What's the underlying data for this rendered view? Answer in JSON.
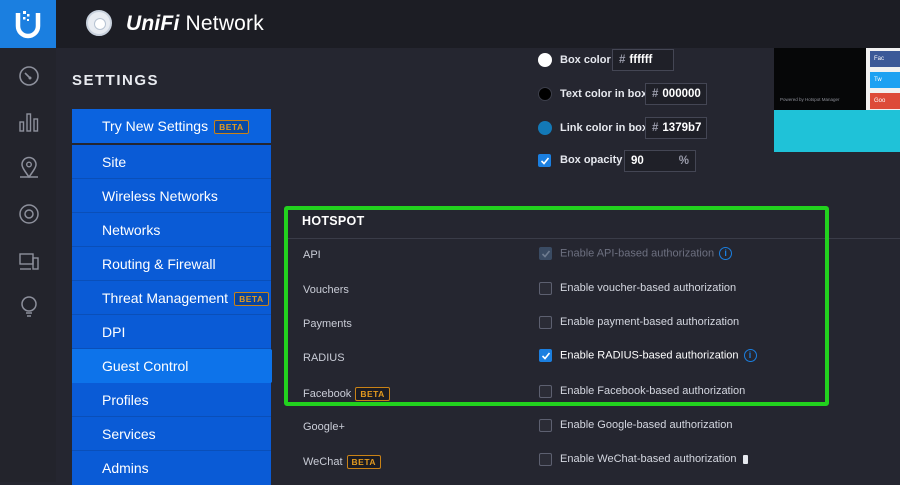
{
  "app": {
    "title_prefix": "UniFi",
    "title_suffix": " Network",
    "logo_icon": "unifi-u-icon"
  },
  "rail": {
    "icons": [
      "dashboard-icon",
      "statistics-icon",
      "map-icon",
      "devices-icon",
      "clients-icon",
      "insights-icon"
    ]
  },
  "settings": {
    "title": "SETTINGS",
    "items": [
      {
        "label": "Try New Settings",
        "beta": "BETA"
      },
      {
        "label": "Site",
        "beta": ""
      },
      {
        "label": "Wireless Networks",
        "beta": ""
      },
      {
        "label": "Networks",
        "beta": ""
      },
      {
        "label": "Routing & Firewall",
        "beta": ""
      },
      {
        "label": "Threat Management",
        "beta": "BETA"
      },
      {
        "label": "DPI",
        "beta": ""
      },
      {
        "label": "Guest Control",
        "beta": "",
        "active": true
      },
      {
        "label": "Profiles",
        "beta": ""
      },
      {
        "label": "Services",
        "beta": ""
      },
      {
        "label": "Admins",
        "beta": ""
      }
    ]
  },
  "portal_style": {
    "box_color": {
      "label": "Box color",
      "value": "ffffff",
      "swatch": "#ffffff"
    },
    "text_color": {
      "label": "Text color in box",
      "value": "000000",
      "swatch": "#000000"
    },
    "link_color": {
      "label": "Link color in box",
      "value": "1379b7",
      "swatch": "#1379b7"
    },
    "box_opacity": {
      "label": "Box opacity",
      "value": "90",
      "unit": "%",
      "checked": true
    },
    "hash": "#"
  },
  "preview": {
    "powered_by": "Powered by Hotspot Manager",
    "social": [
      "Fac",
      "Tw",
      "Goo"
    ]
  },
  "hotspot": {
    "title": "HOTSPOT",
    "rows": [
      {
        "label": "API",
        "beta": "",
        "option": "Enable API-based authorization",
        "checked": true,
        "disabled": true,
        "info": true
      },
      {
        "label": "Vouchers",
        "beta": "",
        "option": "Enable voucher-based authorization",
        "checked": false
      },
      {
        "label": "Payments",
        "beta": "",
        "option": "Enable payment-based authorization",
        "checked": false
      },
      {
        "label": "RADIUS",
        "beta": "",
        "option": "Enable RADIUS-based authorization",
        "checked": true,
        "info": true
      },
      {
        "label": "Facebook",
        "beta": "BETA",
        "option": "Enable Facebook-based authorization",
        "checked": false
      },
      {
        "label": "Google+",
        "beta": "",
        "option": "Enable Google-based authorization",
        "checked": false
      },
      {
        "label": "WeChat",
        "beta": "BETA",
        "option": "Enable WeChat-based authorization",
        "checked": false,
        "phone": true
      }
    ]
  },
  "colors": {
    "accent": "#1b7fe0",
    "nav": "#0a5bd6",
    "highlight": "#22d21e",
    "beta": "#e39a1f"
  }
}
